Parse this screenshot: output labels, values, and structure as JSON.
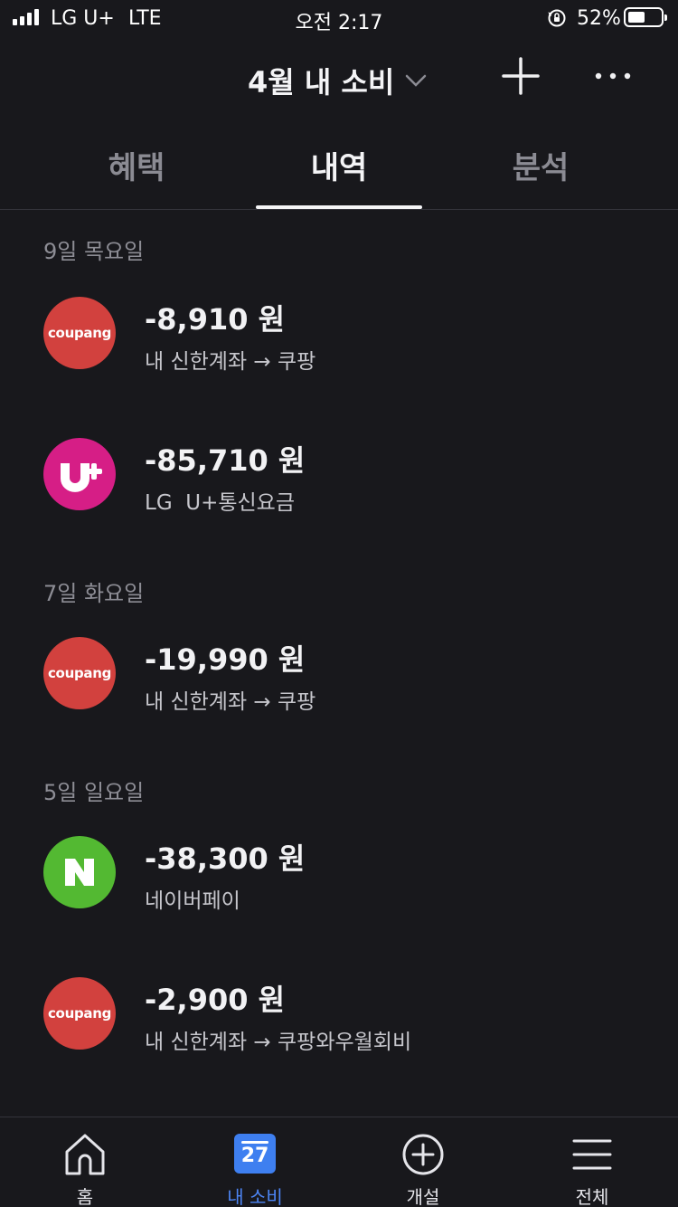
{
  "status_bar": {
    "carrier": "LG U+",
    "network": "LTE",
    "time": "오전 2:17",
    "battery_percent": "52%",
    "battery_level": 0.52
  },
  "header": {
    "title": "4월 내 소비"
  },
  "tabs": [
    {
      "label": "혜택",
      "active": false
    },
    {
      "label": "내역",
      "active": true
    },
    {
      "label": "분석",
      "active": false
    }
  ],
  "transactions": {
    "groups": [
      {
        "date": "9일 목요일",
        "items": [
          {
            "logo": "coupang",
            "logo_text": "coupang",
            "amount": "-8,910 원",
            "description": "내 신한계좌 → 쿠팡"
          },
          {
            "logo": "uplus",
            "amount": "-85,710 원",
            "description": "LG  U+통신요금"
          }
        ]
      },
      {
        "date": "7일 화요일",
        "items": [
          {
            "logo": "coupang",
            "logo_text": "coupang",
            "amount": "-19,990 원",
            "description": "내 신한계좌 → 쿠팡"
          }
        ]
      },
      {
        "date": "5일 일요일",
        "items": [
          {
            "logo": "naver",
            "amount": "-38,300 원",
            "description": "네이버페이"
          },
          {
            "logo": "coupang",
            "logo_text": "coupang",
            "amount": "-2,900 원",
            "description": "내 신한계좌 → 쿠팡와우월회비"
          }
        ]
      }
    ]
  },
  "bottom_nav": {
    "items": [
      {
        "label": "홈",
        "icon": "home-icon",
        "active": false
      },
      {
        "label": "내 소비",
        "icon": "calendar-icon",
        "badge": "27",
        "active": true
      },
      {
        "label": "개설",
        "icon": "plus-circle-icon",
        "active": false
      },
      {
        "label": "전체",
        "icon": "menu-icon",
        "active": false
      }
    ]
  },
  "colors": {
    "background": "#18181c",
    "accent": "#3e7ff0",
    "coupang": "#d2413e",
    "uplus": "#d61e86",
    "naver": "#53b932"
  }
}
